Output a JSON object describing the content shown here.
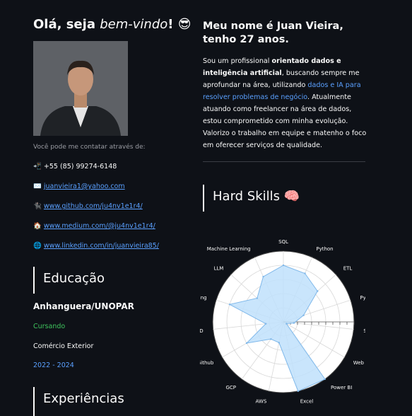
{
  "greeting": {
    "prefix": "Olá, seja ",
    "emph": "bem-vindo",
    "suffix": "! 😎"
  },
  "contact": {
    "intro": "Você pode me contatar através de:",
    "phone_icon": "📲",
    "phone": "+55 (85) 99274-6148",
    "email_icon": "✉️",
    "email": "juanvieira1@yahoo.com",
    "github_icon": "🐈‍⬛",
    "github": "www.github.com/ju4nv1e1r4/",
    "medium_icon": "🏠",
    "medium": "www.medium.com/@ju4nv1e1r4/",
    "linkedin_icon": "🌐",
    "linkedin": "www.linkedin.com/in/juanvieira85/"
  },
  "education": {
    "title": "Educação",
    "institution": "Anhanguera/UNOPAR",
    "status": "Cursando",
    "course": "Comércio Exterior",
    "period": "2022 - 2024"
  },
  "experience": {
    "title": "Experiências"
  },
  "about": {
    "name_title": "Meu nome é Juan Vieira, tenho 27 anos.",
    "p1": "Sou um profissional ",
    "b1": "orientado dados e inteligência artificial",
    "p2": ", buscando sempre me aprofundar na área, utilizando ",
    "link": "dados e IA para resolver problemas de negócio",
    "p3": ". Atualmente atuando como freelancer na área de dados, estou comprometido com minha evolução. Valorizo o trabalho em equipe e matenho o foco em oferecer serviços de qualidade."
  },
  "hard_skills": {
    "title": "Hard Skills 🧠"
  },
  "chart_data": {
    "type": "radar",
    "categories": [
      "SQL",
      "Python",
      "ETL",
      "Pyspark",
      "Streamlit",
      "Web Scraping",
      "Power BI",
      "Excel",
      "AWS",
      "GCP",
      "Git/Github",
      "CI/CD",
      "Data Modeling",
      "LLM",
      "Machine Learning"
    ],
    "values": [
      8,
      7.5,
      6.5,
      3,
      1.5,
      0.5,
      10,
      10,
      3,
      3,
      6,
      2.5,
      8,
      5,
      7
    ],
    "range": [
      0,
      10
    ],
    "grid": true,
    "colors": {
      "fill": "#bfe0fb",
      "stroke": "#7fb8ea"
    }
  }
}
